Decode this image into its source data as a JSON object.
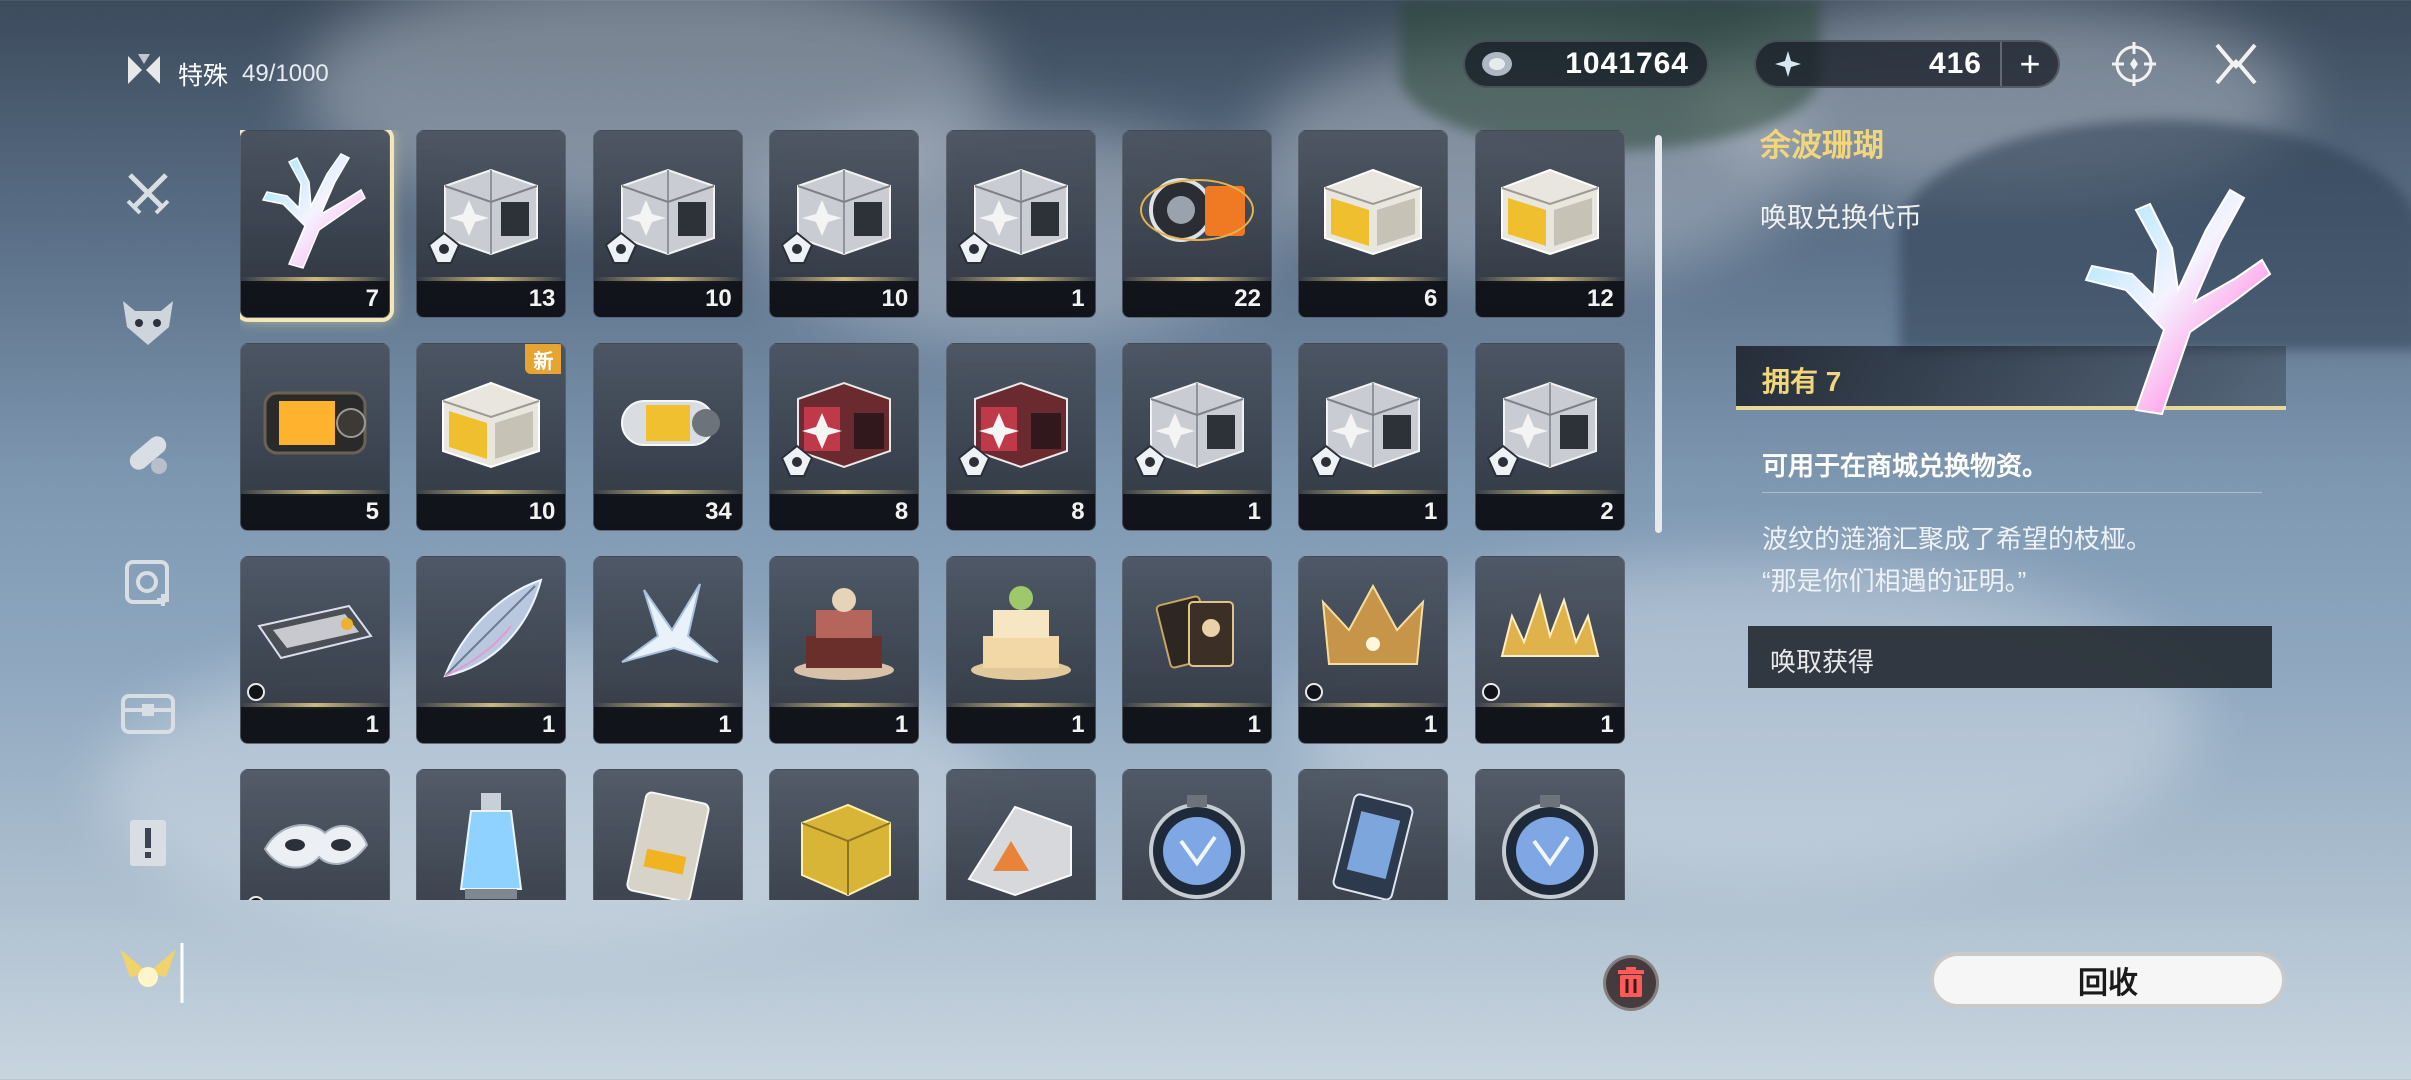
{
  "header": {
    "category_label": "特殊",
    "capacity": "49/1000",
    "currency_a_value": "1041764",
    "currency_b_value": "416",
    "currency_b_plus": "+"
  },
  "colors": {
    "accent_gold": "#f2d67c",
    "selected_outline": "#f4e7b7",
    "new_badge": "#e6a532"
  },
  "nav_icons": [
    "crossed-swords-icon",
    "demon-mask-icon",
    "capsule-icon",
    "gear-plus-icon",
    "chest-icon",
    "notice-icon",
    "winged-emblem-icon"
  ],
  "grid": {
    "items": [
      {
        "art": "coral",
        "count": "7",
        "selected": true
      },
      {
        "art": "box-silver",
        "count": "13",
        "emblem": true
      },
      {
        "art": "box-silver",
        "count": "10",
        "emblem": true
      },
      {
        "art": "box-silver",
        "count": "10",
        "emblem": true
      },
      {
        "art": "box-silver",
        "count": "1",
        "emblem": true
      },
      {
        "art": "device-orange",
        "count": "22"
      },
      {
        "art": "box-gold",
        "count": "6"
      },
      {
        "art": "box-gold",
        "count": "12"
      },
      {
        "art": "canister-orange",
        "count": "5"
      },
      {
        "art": "box-gold",
        "count": "10",
        "badge": "新"
      },
      {
        "art": "cylinder",
        "count": "34"
      },
      {
        "art": "box-red",
        "count": "8",
        "emblem": true
      },
      {
        "art": "box-red",
        "count": "8",
        "emblem": true
      },
      {
        "art": "box-silver",
        "count": "1",
        "emblem": true
      },
      {
        "art": "box-silver",
        "count": "1",
        "emblem": true
      },
      {
        "art": "box-silver",
        "count": "2",
        "emblem": true
      },
      {
        "art": "card",
        "count": "1",
        "mini": true
      },
      {
        "art": "crystal-leaf",
        "count": "1"
      },
      {
        "art": "paper-crane",
        "count": "1"
      },
      {
        "art": "cake-dark",
        "count": "1"
      },
      {
        "art": "cake-light",
        "count": "1"
      },
      {
        "art": "cards",
        "count": "1"
      },
      {
        "art": "crown",
        "count": "1",
        "mini": true
      },
      {
        "art": "tiara",
        "count": "1",
        "mini": true
      },
      {
        "art": "mask",
        "count": "",
        "mini": true
      },
      {
        "art": "potion",
        "count": ""
      },
      {
        "art": "device-card",
        "count": ""
      },
      {
        "art": "gold-cube",
        "count": "",
        "purple": true
      },
      {
        "art": "triangle-box",
        "count": "",
        "purple": true
      },
      {
        "art": "medal",
        "count": "",
        "purple": true
      },
      {
        "art": "phone-card",
        "count": "",
        "purple": true
      },
      {
        "art": "medal",
        "count": "",
        "purple": true
      }
    ]
  },
  "detail": {
    "title": "余波珊瑚",
    "subtitle": "唤取兑换代币",
    "owned": "拥有 7",
    "description": "可用于在商城兑换物资。",
    "lore_line1": "波纹的涟漪汇聚成了希望的枝桠。",
    "lore_line2": "“那是你们相遇的证明。”",
    "source_label": "唤取获得"
  },
  "actions": {
    "recycle_label": "回收"
  }
}
